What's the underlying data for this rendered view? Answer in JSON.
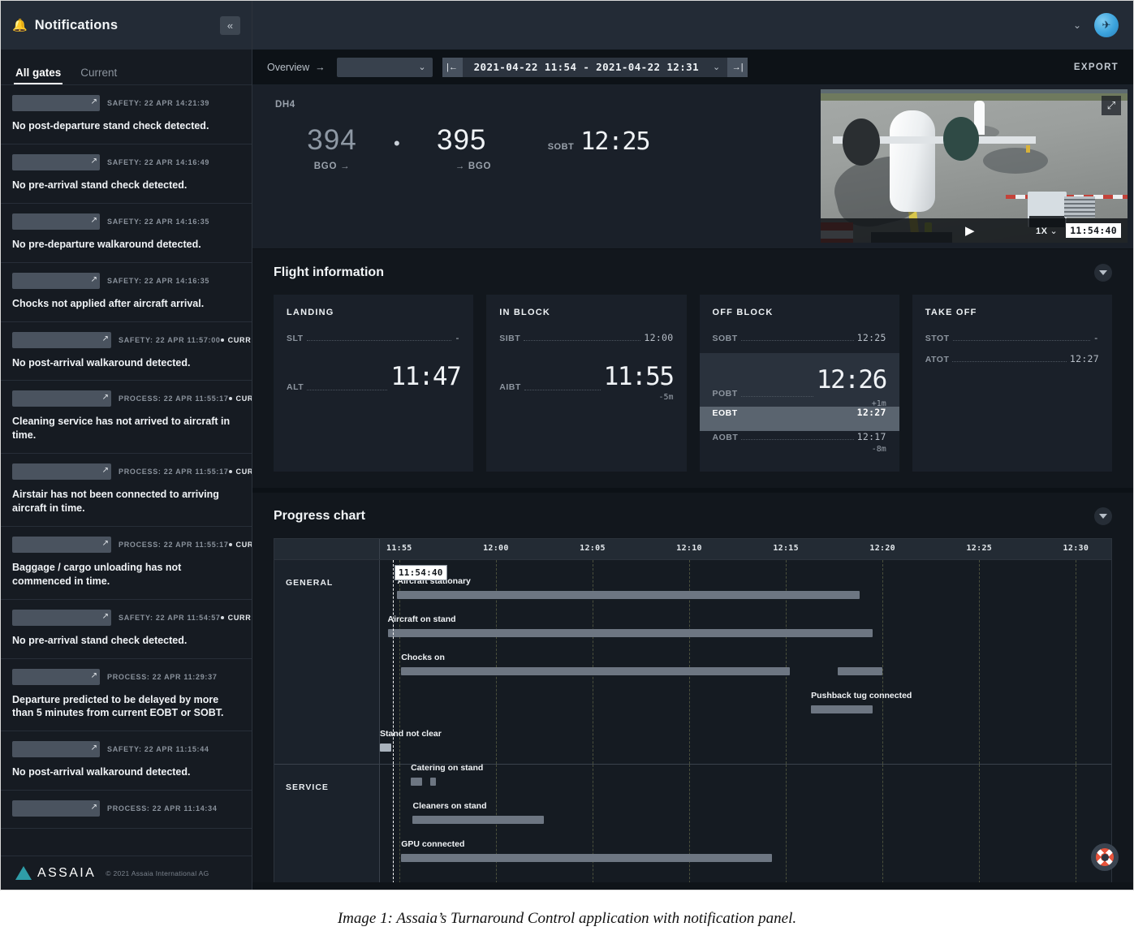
{
  "sidebar": {
    "title": "Notifications",
    "bell_icon": "bell-icon",
    "collapse_icon": "«",
    "tabs": [
      {
        "label": "All gates",
        "active": true
      },
      {
        "label": "Current",
        "active": false
      }
    ],
    "current_badge": "CURRENT",
    "notifications": [
      {
        "meta": "SAFETY: 22 APR 14:21:39",
        "text": "No post-departure stand check detected.",
        "current": false
      },
      {
        "meta": "SAFETY: 22 APR 14:16:49",
        "text": "No pre-arrival stand check detected.",
        "current": false
      },
      {
        "meta": "SAFETY: 22 APR 14:16:35",
        "text": "No pre-departure walkaround detected.",
        "current": false
      },
      {
        "meta": "SAFETY: 22 APR 14:16:35",
        "text": "Chocks not applied after aircraft arrival.",
        "current": false
      },
      {
        "meta": "SAFETY: 22 APR 11:57:00",
        "text": "No post-arrival walkaround detected.",
        "current": true
      },
      {
        "meta": "PROCESS: 22 APR 11:55:17",
        "text": "Cleaning service has not arrived to aircraft in time.",
        "current": true
      },
      {
        "meta": "PROCESS: 22 APR 11:55:17",
        "text": "Airstair has not been connected to arriving aircraft in time.",
        "current": true
      },
      {
        "meta": "PROCESS: 22 APR 11:55:17",
        "text": "Baggage / cargo unloading has not commenced in time.",
        "current": true
      },
      {
        "meta": "SAFETY: 22 APR 11:54:57",
        "text": "No pre-arrival stand check detected.",
        "current": true
      },
      {
        "meta": "PROCESS: 22 APR 11:29:37",
        "text": "Departure predicted to be delayed by more than 5 minutes from current EOBT or SOBT.",
        "current": false
      },
      {
        "meta": "SAFETY: 22 APR 11:15:44",
        "text": "No post-arrival walkaround detected.",
        "current": false
      },
      {
        "meta": "PROCESS: 22 APR 11:14:34",
        "text": "",
        "current": false
      }
    ],
    "footer": {
      "logo": "ASSAIA",
      "copyright": "© 2021 Assaia International AG"
    }
  },
  "topbar": {
    "chevron": "⌄",
    "avatar_icon": "plane-avatar"
  },
  "toolbar": {
    "view_label": "Overview",
    "view_arrow": "→",
    "gate_select_value": "",
    "gate_select_chevron": "⌄",
    "prev_icon": "|←",
    "next_icon": "→|",
    "range": "2021-04-22 11:54 - 2021-04-22 12:31",
    "range_chevron": "⌄",
    "export_label": "EXPORT"
  },
  "flight": {
    "aircraft_type": "DH4",
    "inbound_number": "394",
    "separator": "•",
    "outbound_number": "395",
    "inbound_code": "BGO →",
    "outbound_code": "→ BGO",
    "sobt_label": "SOBT",
    "sobt_value": "12:25"
  },
  "video": {
    "expand_icon": "⤢",
    "play_icon": "▶",
    "speed": "1X",
    "speed_chevron": "⌄",
    "timestamp": "11:54:40"
  },
  "flight_information": {
    "title": "Flight information",
    "toggle_icon": "chevron-down-icon",
    "cards": [
      {
        "title": "LANDING",
        "rows": [
          {
            "label": "SLT",
            "value": "-",
            "big": false,
            "highlight": "none",
            "delta": ""
          },
          {
            "label": "ALT",
            "value": "11:47",
            "big": true,
            "highlight": "none",
            "delta": ""
          }
        ]
      },
      {
        "title": "IN BLOCK",
        "rows": [
          {
            "label": "SIBT",
            "value": "12:00",
            "big": false,
            "highlight": "none",
            "delta": ""
          },
          {
            "label": "AIBT",
            "value": "11:55",
            "big": true,
            "highlight": "none",
            "delta": "-5m"
          }
        ]
      },
      {
        "title": "OFF BLOCK",
        "rows": [
          {
            "label": "SOBT",
            "value": "12:25",
            "big": false,
            "highlight": "none",
            "delta": ""
          },
          {
            "label": "POBT",
            "value": "12:26",
            "big": true,
            "highlight": "dark",
            "delta": "+1m"
          },
          {
            "label": "EOBT",
            "value": "12:27",
            "big": false,
            "highlight": "light",
            "delta": ""
          },
          {
            "label": "AOBT",
            "value": "12:17",
            "big": false,
            "highlight": "none",
            "delta": "-8m"
          }
        ]
      },
      {
        "title": "TAKE OFF",
        "rows": [
          {
            "label": "STOT",
            "value": "-",
            "big": false,
            "highlight": "none",
            "delta": ""
          },
          {
            "label": "ATOT",
            "value": "12:27",
            "big": false,
            "highlight": "none",
            "delta": ""
          }
        ]
      }
    ]
  },
  "progress_chart": {
    "title": "Progress chart",
    "toggle_icon": "chevron-down-icon",
    "now_marker": "11:54:40",
    "help_icon": "lifebuoy-icon"
  },
  "chart_data": {
    "type": "bar",
    "title": "Progress chart",
    "xlabel": "",
    "ylabel": "",
    "x_ticks": [
      "11:55",
      "12:00",
      "12:05",
      "12:10",
      "12:15",
      "12:20",
      "12:25",
      "12:30"
    ],
    "x_tick_minutes": [
      1,
      6,
      11,
      16,
      21,
      26,
      31,
      36
    ],
    "xlim_minutes": [
      0,
      38
    ],
    "grid": true,
    "legend": "none",
    "now_marker_minutes": 0.67,
    "groups": [
      {
        "name": "GENERAL",
        "events": [
          {
            "label": "Aircraft stationary",
            "segments": [
              {
                "start_min": 0.9,
                "end_min": 24.8
              }
            ],
            "shade": "mid"
          },
          {
            "label": "Aircraft on stand",
            "segments": [
              {
                "start_min": 0.4,
                "end_min": 25.5
              }
            ],
            "shade": "mid"
          },
          {
            "label": "Chocks on",
            "segments": [
              {
                "start_min": 1.1,
                "end_min": 21.2
              },
              {
                "start_min": 23.7,
                "end_min": 26.0
              }
            ],
            "shade": "mid"
          },
          {
            "label": "Pushback tug connected",
            "segments": [
              {
                "start_min": 22.3,
                "end_min": 25.5
              }
            ],
            "shade": "mid"
          },
          {
            "label": "Stand not clear",
            "segments": [
              {
                "start_min": -0.5,
                "end_min": 0.6
              }
            ],
            "shade": "light"
          }
        ]
      },
      {
        "name": "SERVICE",
        "events": [
          {
            "label": "Catering on stand",
            "segments": [
              {
                "start_min": 1.6,
                "end_min": 2.2
              },
              {
                "start_min": 2.6,
                "end_min": 2.9
              }
            ],
            "shade": "mid"
          },
          {
            "label": "Cleaners on stand",
            "segments": [
              {
                "start_min": 1.7,
                "end_min": 8.5
              }
            ],
            "shade": "mid"
          },
          {
            "label": "GPU connected",
            "segments": [
              {
                "start_min": 1.1,
                "end_min": 20.3
              }
            ],
            "shade": "mid"
          }
        ]
      }
    ]
  },
  "caption": "Image 1: Assaia’s Turnaround Control application with notification panel."
}
